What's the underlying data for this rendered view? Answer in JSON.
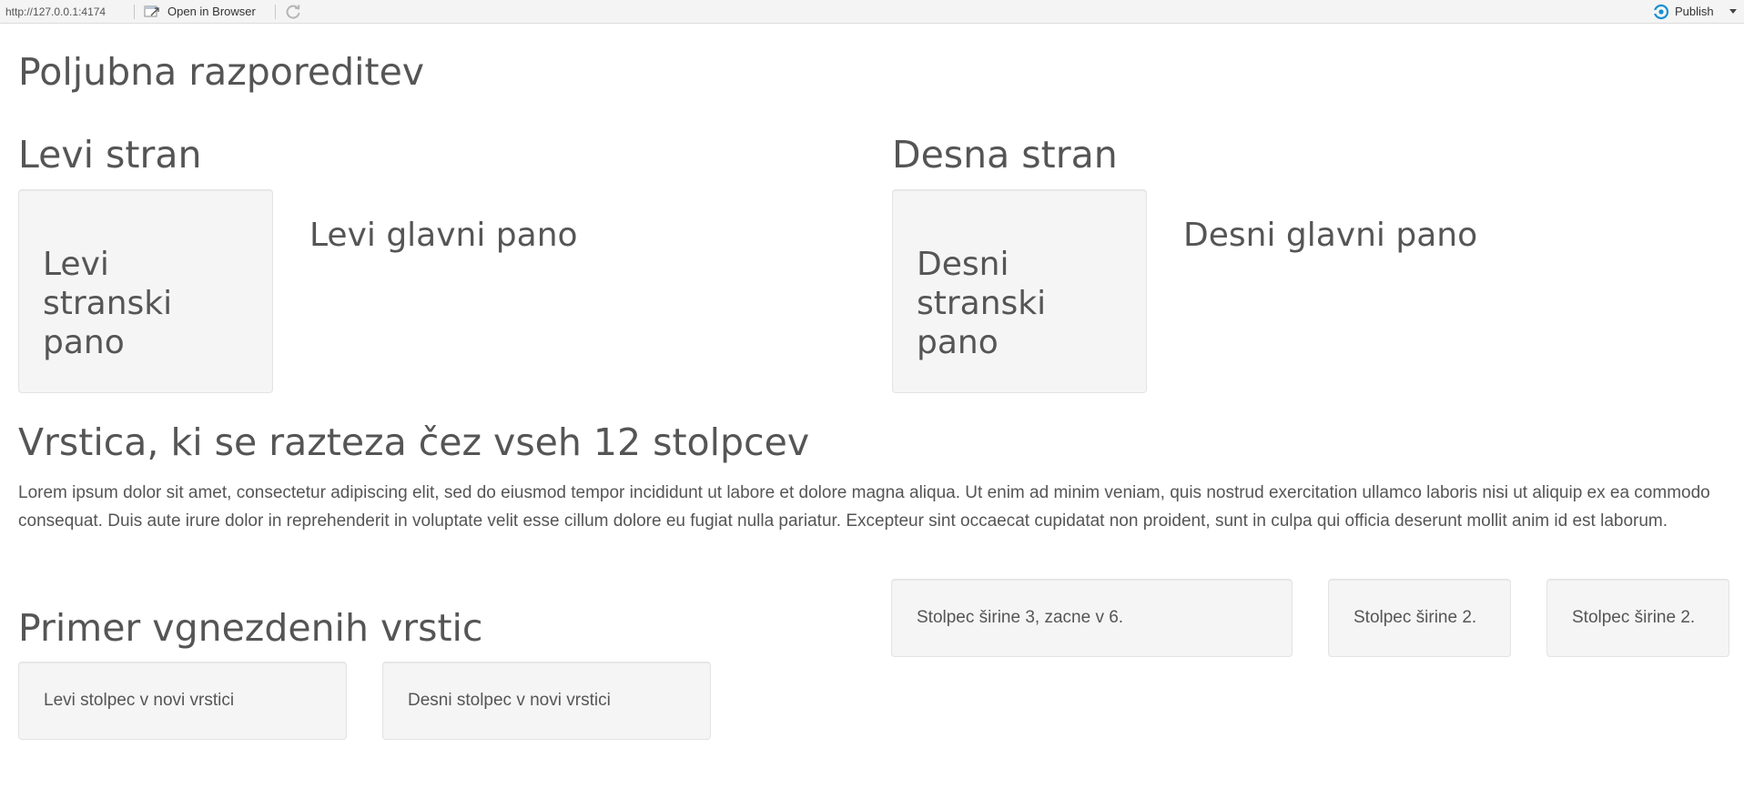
{
  "toolbar": {
    "url": "http://127.0.0.1:4174",
    "open_label": "Open in Browser",
    "publish_label": "Publish",
    "icons": [
      "open-in-browser-icon",
      "refresh-icon",
      "publish-icon",
      "chevron-down-icon"
    ],
    "publish_color": "#1a8fd1"
  },
  "page": {
    "title": "Poljubna razporeditev"
  },
  "left": {
    "heading": "Levi stran",
    "sidebar_label": "Levi stranski pano",
    "main_label": "Levi glavni pano"
  },
  "right": {
    "heading": "Desna stran",
    "sidebar_label": "Desni stranski pano",
    "main_label": "Desni glavni pano"
  },
  "full_row": {
    "heading": "Vrstica, ki se razteza čez vseh 12 stolpcev",
    "text": "Lorem ipsum dolor sit amet, consectetur adipiscing elit, sed do eiusmod tempor incididunt ut labore et dolore magna aliqua. Ut enim ad minim veniam, quis nostrud exercitation ullamco laboris nisi ut aliquip ex ea commodo consequat. Duis aute irure dolor in reprehenderit in voluptate velit esse cillum dolore eu fugiat nulla pariatur. Excepteur sint occaecat cupidatat non proident, sunt in culpa qui officia deserunt mollit anim id est laborum."
  },
  "nested": {
    "heading": "Primer vgnezdenih vrstic",
    "left_col": "Levi stolpec v novi vrstici",
    "right_col": "Desni stolpec v novi vrstici"
  },
  "offset_cols": {
    "col_a": "Stolpec širine 3, zacne v 6.",
    "col_b": "Stolpec širine 2.",
    "col_c": "Stolpec širine 2."
  }
}
